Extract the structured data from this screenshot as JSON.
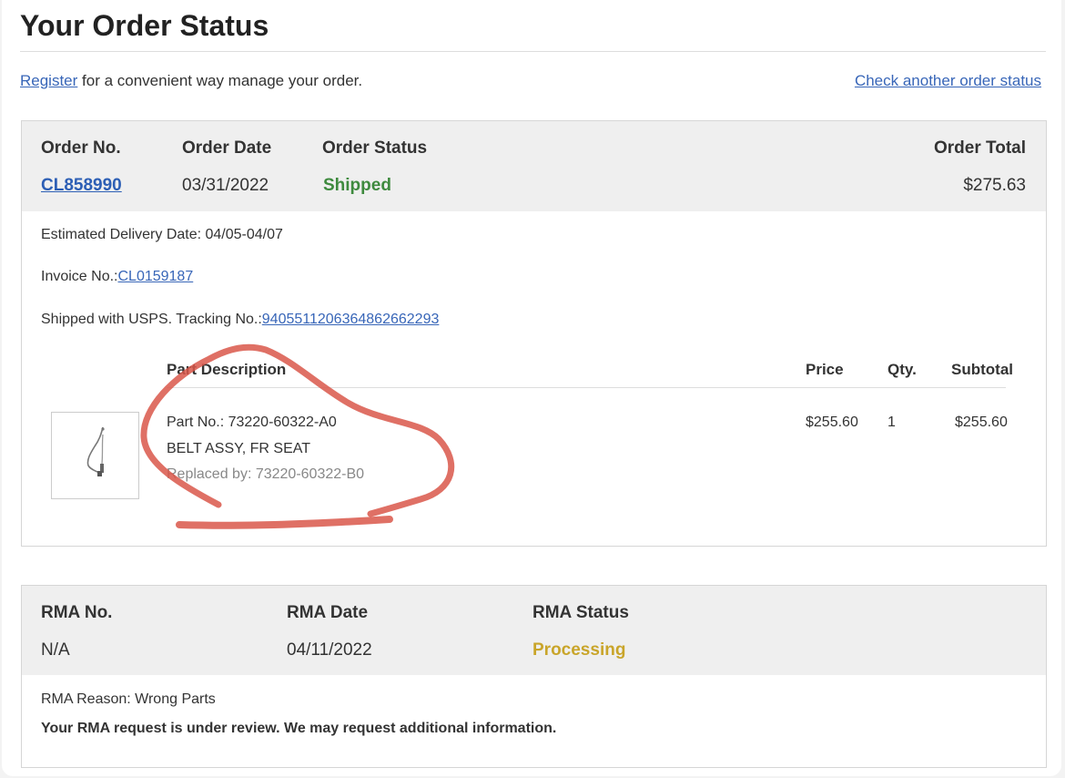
{
  "page_title": "Your Order Status",
  "register": {
    "link_text": "Register",
    "suffix": " for a convenient way manage your order."
  },
  "check_link": "Check another order status",
  "order": {
    "headers": {
      "no": "Order No.",
      "date": "Order Date",
      "status": "Order Status",
      "total": "Order Total"
    },
    "no": "CL858990",
    "date": "03/31/2022",
    "status": "Shipped",
    "total": "$275.63",
    "status_color": "#3e8a3e"
  },
  "details": {
    "delivery": "Estimated Delivery Date: 04/05-04/07",
    "invoice_label": "Invoice No.:",
    "invoice_no": "CL0159187",
    "tracking_label": "Shipped with USPS. Tracking No.:",
    "tracking_no": "9405511206364862662293"
  },
  "items_table": {
    "columns": [
      "Part Description",
      "Price",
      "Qty.",
      "Subtotal"
    ],
    "rows": [
      {
        "part_no": "Part No.: 73220-60322-A0",
        "name": "BELT ASSY, FR SEAT",
        "replaced_by": "Replaced by: 73220-60322-B0",
        "price": "$255.60",
        "qty": "1",
        "subtotal": "$255.60",
        "image_icon": "seat-belt-part-image"
      }
    ]
  },
  "rma": {
    "headers": {
      "no": "RMA No.",
      "date": "RMA Date",
      "status": "RMA Status"
    },
    "no": "N/A",
    "date": "04/11/2022",
    "status": "Processing",
    "status_color": "#c9a52a",
    "reason": "RMA Reason: Wrong Parts",
    "note": "Your RMA request is under review. We may request additional information."
  },
  "annotation_color": "#d9574a"
}
